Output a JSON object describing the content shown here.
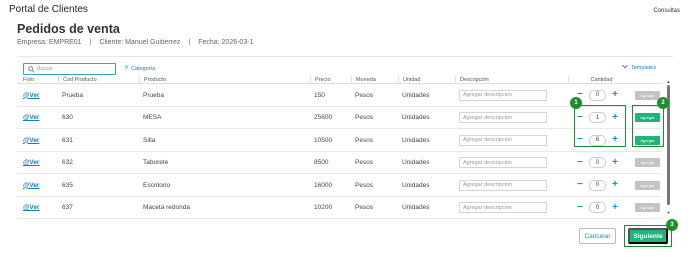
{
  "header": {
    "portal_title": "Portal de Clientes",
    "consultas": "Consultas"
  },
  "page": {
    "title": "Pedidos de venta",
    "empresa": "Empresa: EMPRE01",
    "cliente": "Cliente: Manuel Guitierrez",
    "fecha": "Fecha: 2026-03-1",
    "separator": "|"
  },
  "toolbar": {
    "search_placeholder": "Buscar",
    "categoria": "Categoría",
    "templates": "Templates"
  },
  "table": {
    "headers": [
      "Foto",
      "Cod Producto",
      "Producto",
      "Precio",
      "Moneda",
      "Unidad",
      "Descripción",
      "Cantidad"
    ],
    "desc_placeholder": "Agregar descripcion",
    "agregar_label": "Agregar",
    "ver_label": "@Ver",
    "rows": [
      {
        "codigo": "Prueba",
        "producto": "Prueba",
        "precio": "150",
        "moneda": "Pesos",
        "unidad": "Unidades",
        "cantidad": "0",
        "agregar_enabled": false
      },
      {
        "codigo": "630",
        "producto": "MESA",
        "precio": "25600",
        "moneda": "Pesos",
        "unidad": "Unidades",
        "cantidad": "1",
        "agregar_enabled": true
      },
      {
        "codigo": "631",
        "producto": "Silla",
        "precio": "10500",
        "moneda": "Pesos",
        "unidad": "Unidades",
        "cantidad": "6",
        "agregar_enabled": true
      },
      {
        "codigo": "632",
        "producto": "Taburete",
        "precio": "8500",
        "moneda": "Pesos",
        "unidad": "Unidades",
        "cantidad": "0",
        "agregar_enabled": false
      },
      {
        "codigo": "635",
        "producto": "Escritorio",
        "precio": "16000",
        "moneda": "Pesos",
        "unidad": "Unidades",
        "cantidad": "0",
        "agregar_enabled": false
      },
      {
        "codigo": "637",
        "producto": "Maceta redonda",
        "precio": "10200",
        "moneda": "Pesos",
        "unidad": "Unidades",
        "cantidad": "0",
        "agregar_enabled": false
      }
    ]
  },
  "annotations": {
    "badge1": "1",
    "badge2": "2",
    "badge3": "3",
    "color": "#1d8f2a"
  },
  "actions": {
    "cancelar": "Cancelar",
    "siguiente": "Siguiente"
  },
  "colors": {
    "accent_blue": "#1e8fbd",
    "accent_green": "#21b37a",
    "disabled_gray": "#c3c3c3"
  }
}
